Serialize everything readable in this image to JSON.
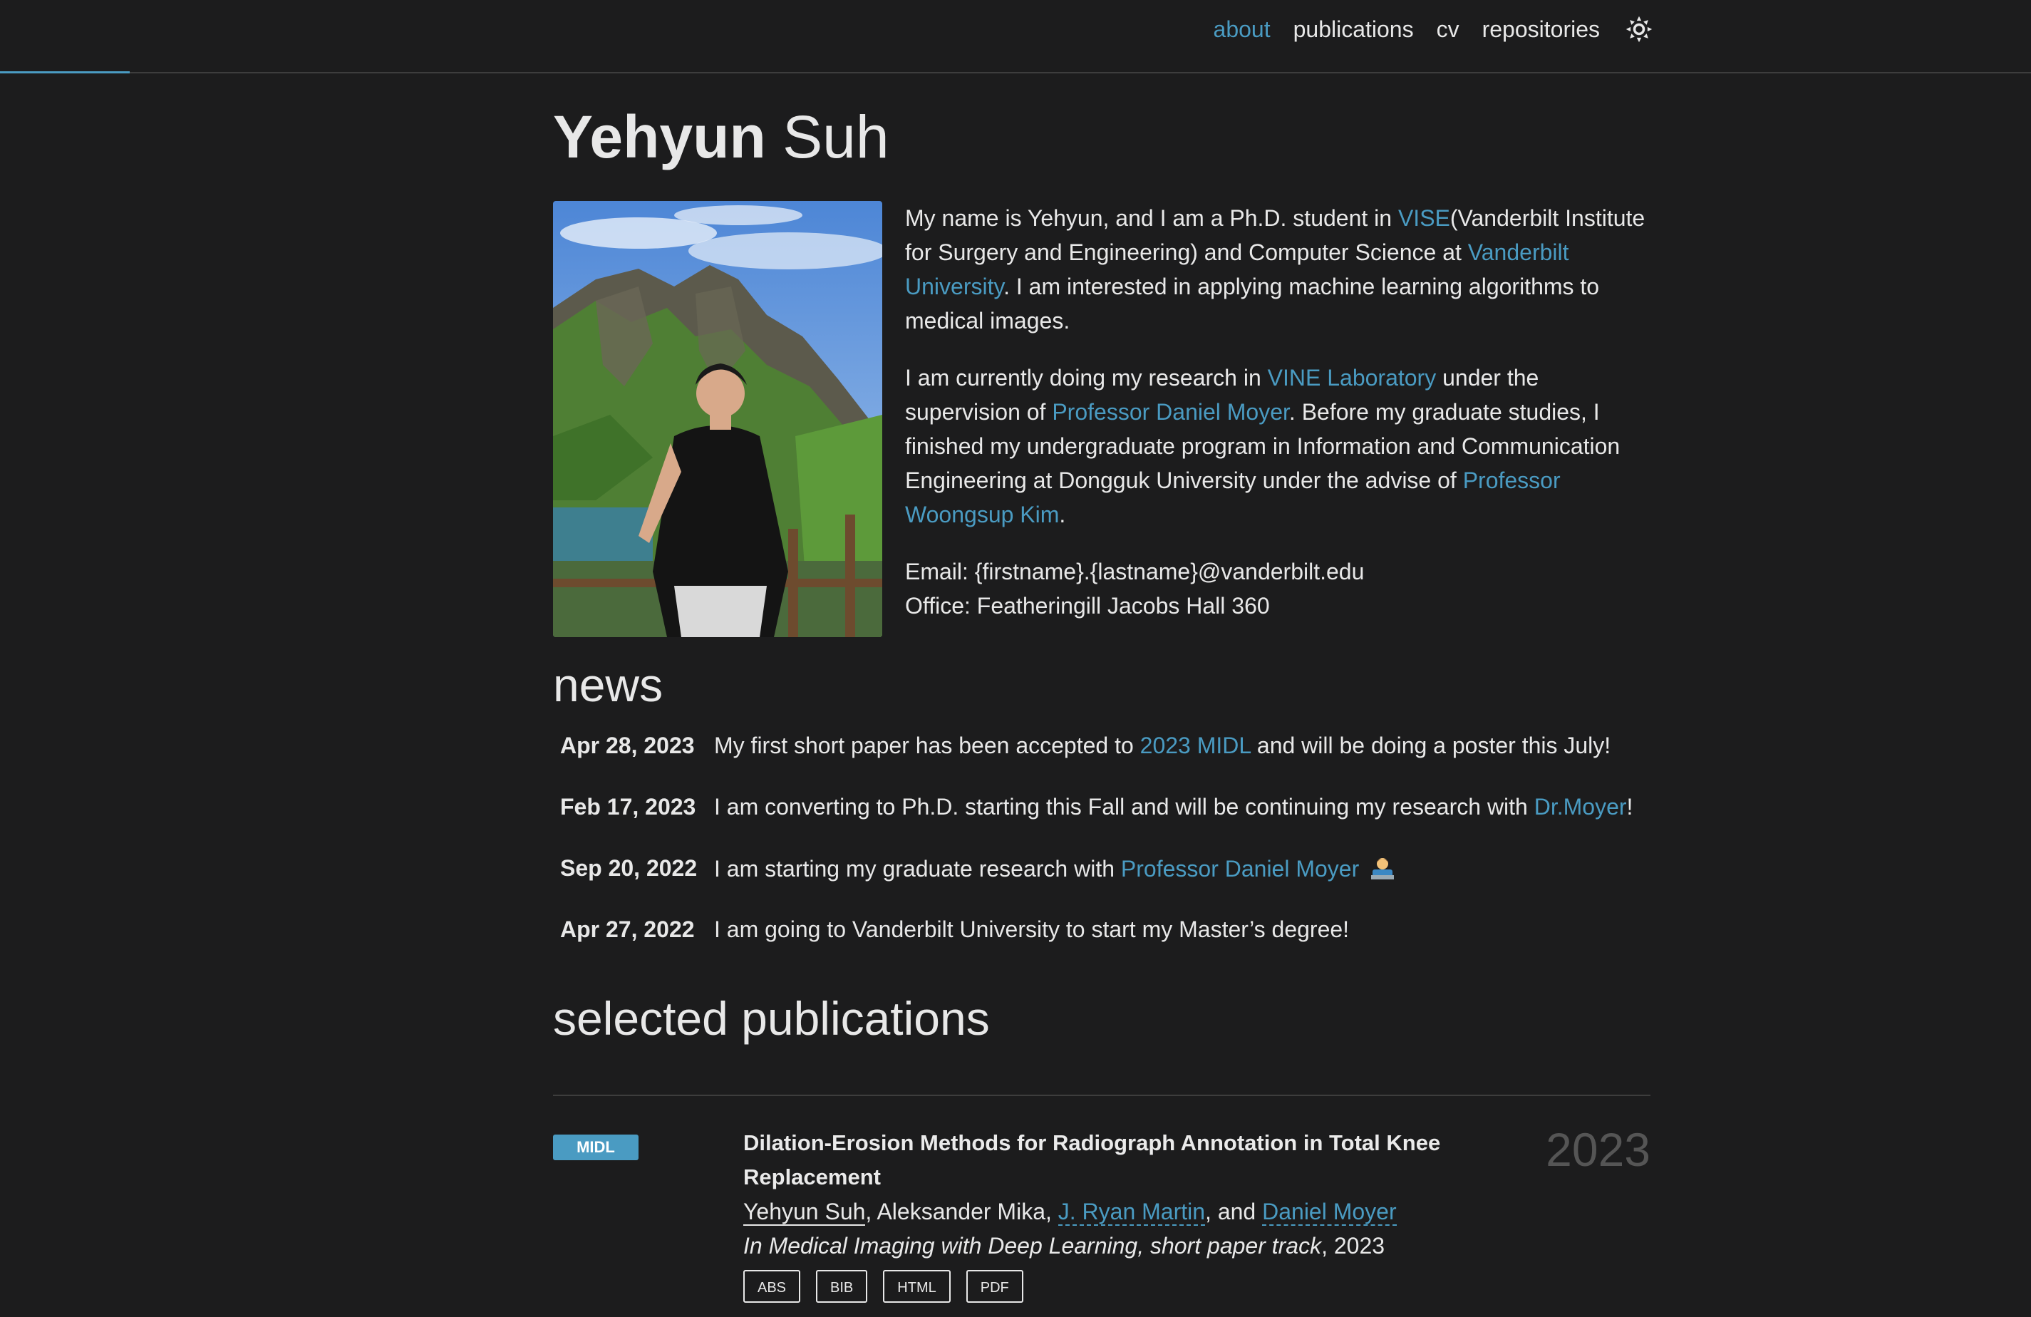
{
  "nav": {
    "items": [
      "about",
      "publications",
      "cv",
      "repositories"
    ],
    "active": "about"
  },
  "header": {
    "first": "Yehyun",
    "last": "Suh"
  },
  "bio": {
    "p1": {
      "a": "My name is Yehyun, and I am a Ph.D. student in ",
      "vise": "VISE",
      "b": "(Vanderbilt Institute for Surgery and Engineering) and Computer Science at ",
      "vu": "Vanderbilt University",
      "c": ". I am interested in applying machine learning algorithms to medical images."
    },
    "p2": {
      "a": "I am currently doing my research in ",
      "lab": "VINE Laboratory",
      "b": " under the supervision of ",
      "prof1": "Professor Daniel Moyer",
      "c": ". Before my graduate studies, I finished my undergraduate program in Information and Communication Engineering at Dongguk University under the advise of ",
      "prof2": "Professor Woongsup Kim",
      "d": "."
    },
    "email": "Email: {firstname}.{lastname}@vanderbilt.edu",
    "office": "Office: Featheringill Jacobs Hall 360"
  },
  "news": {
    "title": "news",
    "items": [
      {
        "date": "Apr 28, 2023",
        "pre": "My first short paper has been accepted to ",
        "link": "2023 MIDL",
        "post": " and will be doing a poster this July!"
      },
      {
        "date": "Feb 17, 2023",
        "pre": "I am converting to Ph.D. starting this Fall and will be continuing my research with ",
        "link": "Dr.Moyer",
        "post": "!"
      },
      {
        "date": "Sep 20, 2022",
        "pre": "I am starting my graduate research with ",
        "link": "Professor Daniel Moyer",
        "post": ""
      },
      {
        "date": "Apr 27, 2022",
        "pre": "I am going to Vanderbilt University to start my Master’s degree!",
        "link": "",
        "post": ""
      }
    ]
  },
  "publications": {
    "title": "selected publications",
    "items": [
      {
        "badge": "MIDL",
        "title": "Dilation-Erosion Methods for Radiograph Annotation in Total Knee Replacement",
        "author_me": "Yehyun Suh",
        "author_sep1": ", Aleksander Mika, ",
        "author_link1": "J. Ryan Martin",
        "author_sep2": ", and ",
        "author_link2": "Daniel Moyer",
        "venue_italic": "In Medical Imaging with Deep Learning, short paper track",
        "venue_year": ", 2023",
        "year": "2023",
        "buttons": [
          "ABS",
          "BIB",
          "HTML",
          "PDF"
        ]
      }
    ]
  },
  "colors": {
    "background": "#1c1c1d",
    "accent": "#4a9bc2",
    "text": "#e8e8e8",
    "muted_year": "#555555"
  }
}
